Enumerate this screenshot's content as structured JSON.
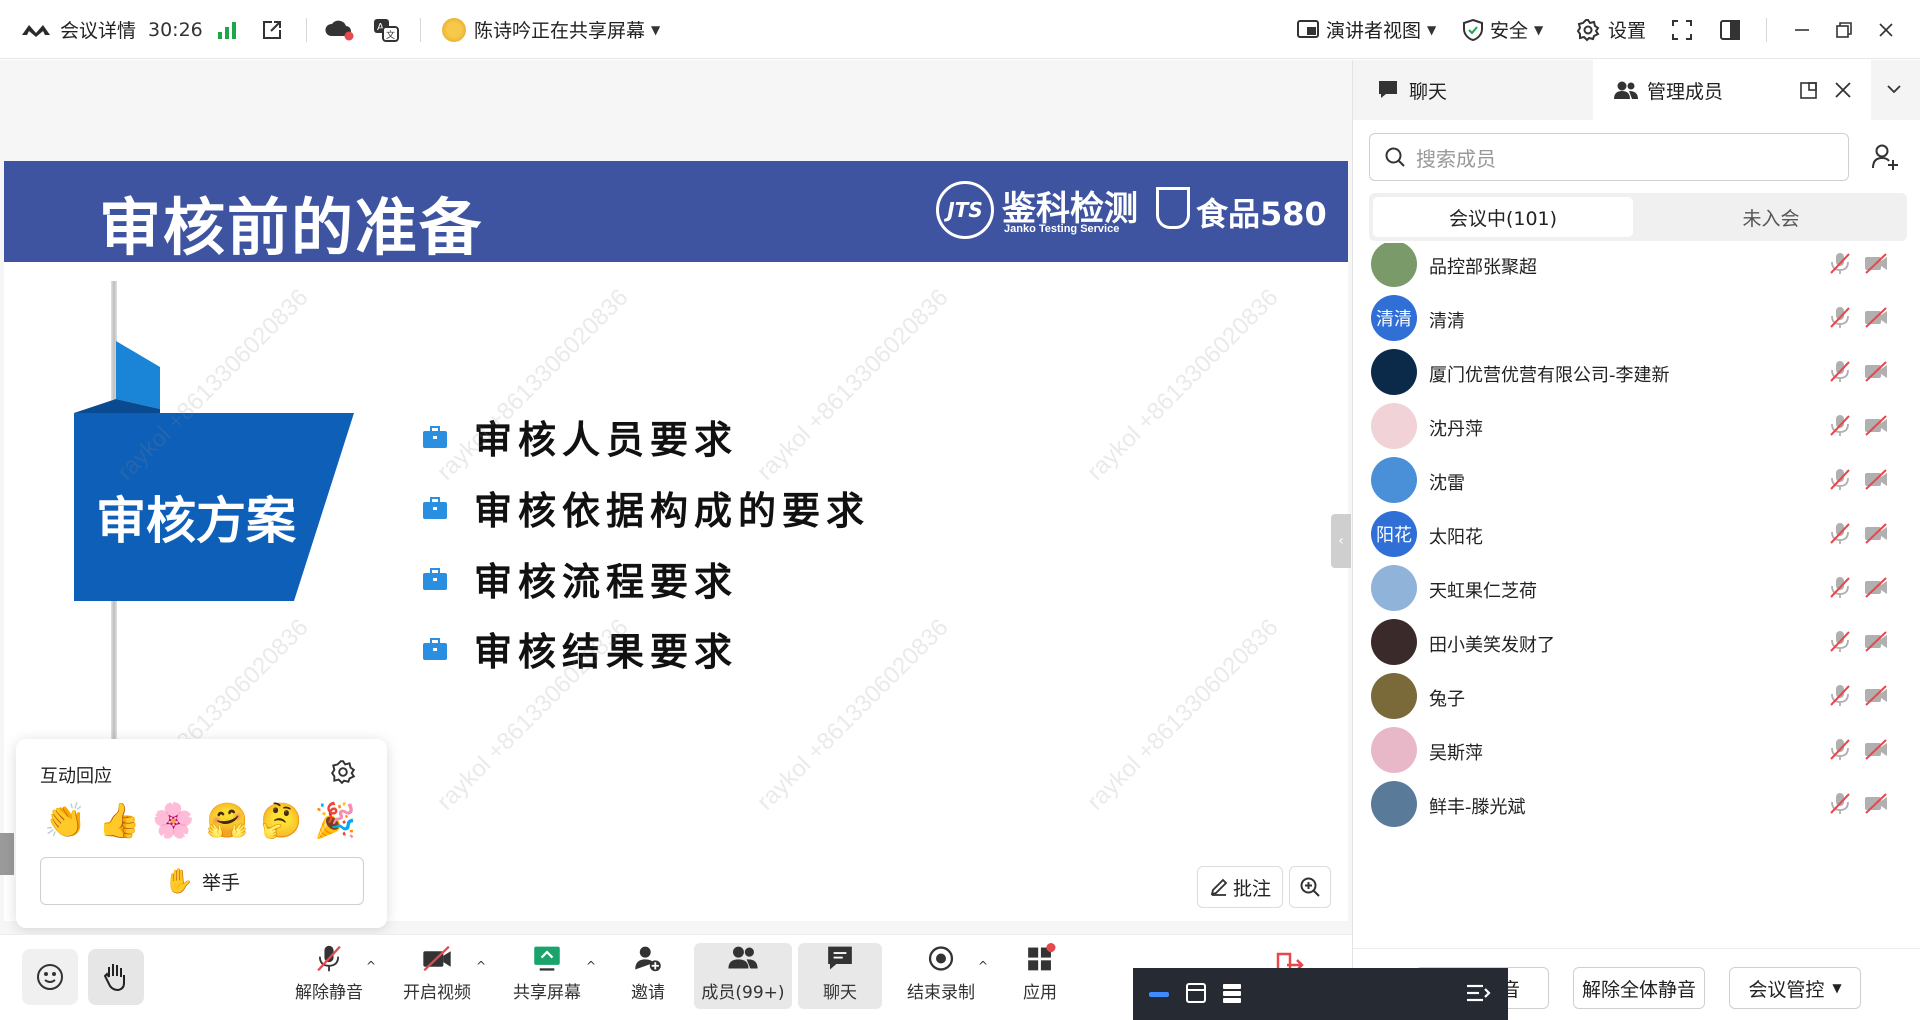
{
  "topbar": {
    "meeting_details": "会议详情",
    "timer": "30:26",
    "sharing_status": "陈诗吟正在共享屏幕",
    "presenter_view": "演讲者视图",
    "security": "安全",
    "settings": "设置"
  },
  "slide": {
    "title": "审核前的准备",
    "brand_name": "鉴科检测",
    "brand_sub": "Janko Testing Service",
    "brand_logo_text": "JTS",
    "partner_logo": "食品580",
    "section_label": "审核方案",
    "bullets": [
      "审核人员要求",
      "审核依据构成的要求",
      "审核流程要求",
      "审核结果要求"
    ],
    "watermark": "raykol +8613306020836"
  },
  "reactions": {
    "title": "互动回应",
    "emojis": [
      "👏",
      "👍",
      "🌸",
      "🤗",
      "🤔",
      "🎉"
    ],
    "raise_hand_icon": "✋",
    "raise_hand": "举手"
  },
  "stage_tools": {
    "annotate": "批注"
  },
  "bottombar": {
    "unmute": "解除静音",
    "start_video": "开启视频",
    "share_screen": "共享屏幕",
    "invite": "邀请",
    "members": "成员(99+)",
    "chat": "聊天",
    "end_recording": "结束录制",
    "apps": "应用"
  },
  "panel": {
    "tab_chat": "聊天",
    "tab_members": "管理成员",
    "search_placeholder": "搜索成员",
    "seg_in_meeting": "会议中(101)",
    "seg_not_joined": "未入会",
    "members": [
      {
        "name": "品控部张聚超",
        "avatar_text": "",
        "color": "#7a9a6a"
      },
      {
        "name": "清清",
        "avatar_text": "清清",
        "color": "#2f6fd6"
      },
      {
        "name": "厦门优营优营有限公司-李建新",
        "avatar_text": "",
        "color": "#0b2a4a"
      },
      {
        "name": "沈丹萍",
        "avatar_text": "",
        "color": "#f1d2d6"
      },
      {
        "name": "沈雷",
        "avatar_text": "",
        "color": "#4a90d9"
      },
      {
        "name": "太阳花",
        "avatar_text": "阳花",
        "color": "#2f6fd6"
      },
      {
        "name": "天虹果仁芝荷",
        "avatar_text": "",
        "color": "#8fb3d9"
      },
      {
        "name": "田小美笑发财了",
        "avatar_text": "",
        "color": "#3a2a2a"
      },
      {
        "name": "兔子",
        "avatar_text": "",
        "color": "#7a6a3a"
      },
      {
        "name": "吴斯萍",
        "avatar_text": "",
        "color": "#e8b8c8"
      },
      {
        "name": "鲜丰-滕光斌",
        "avatar_text": "",
        "color": "#5a7a9a"
      }
    ],
    "footer_mute_all": "全体静音",
    "footer_unmute_all": "解除全体静音",
    "footer_control": "会议管控"
  },
  "colors": {
    "slide_header": "#3f54a0",
    "section_blue": "#0e5fb8",
    "accent_blue": "#2f6fd6",
    "muted_red": "#e5484d"
  }
}
